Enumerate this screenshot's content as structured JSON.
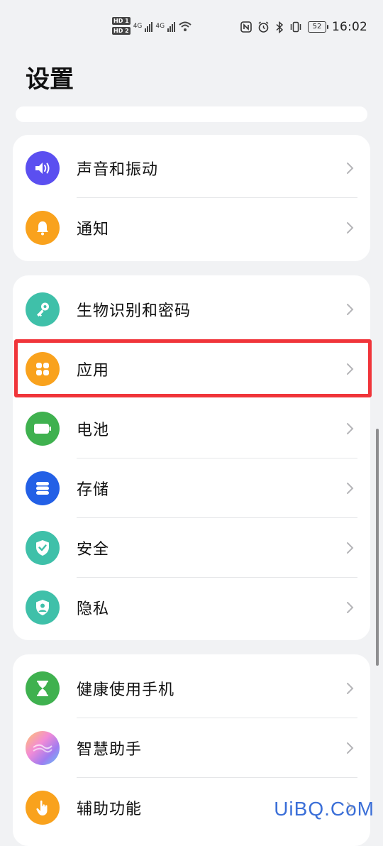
{
  "status_bar": {
    "hd1": "HD 1",
    "hd2": "HD 2",
    "net1": "4G",
    "net2": "4G",
    "battery": "52",
    "time": "16:02"
  },
  "page": {
    "title": "设置"
  },
  "groups": [
    {
      "items": [
        {
          "label": "声音和振动",
          "icon": "speaker-icon",
          "color": "#5b4ff0"
        },
        {
          "label": "通知",
          "icon": "bell-icon",
          "color": "#f9a21d"
        }
      ]
    },
    {
      "items": [
        {
          "label": "生物识别和密码",
          "icon": "key-icon",
          "color": "#3fc0a9"
        },
        {
          "label": "应用",
          "icon": "apps-grid-icon",
          "color": "#f9a21d"
        },
        {
          "label": "电池",
          "icon": "battery-icon",
          "color": "#3fb14f"
        },
        {
          "label": "存储",
          "icon": "storage-icon",
          "color": "#2360e6"
        },
        {
          "label": "安全",
          "icon": "shield-check-icon",
          "color": "#3fc0a9"
        },
        {
          "label": "隐私",
          "icon": "privacy-shield-icon",
          "color": "#3fc0a9"
        }
      ]
    },
    {
      "items": [
        {
          "label": "健康使用手机",
          "icon": "hourglass-icon",
          "color": "#3fb14f"
        },
        {
          "label": "智慧助手",
          "icon": "assistant-icon",
          "color": "#e08ce8"
        },
        {
          "label": "辅助功能",
          "icon": "hand-pointer-icon",
          "color": "#f9a21d"
        }
      ]
    }
  ],
  "watermark": "UiBQ.CoM"
}
